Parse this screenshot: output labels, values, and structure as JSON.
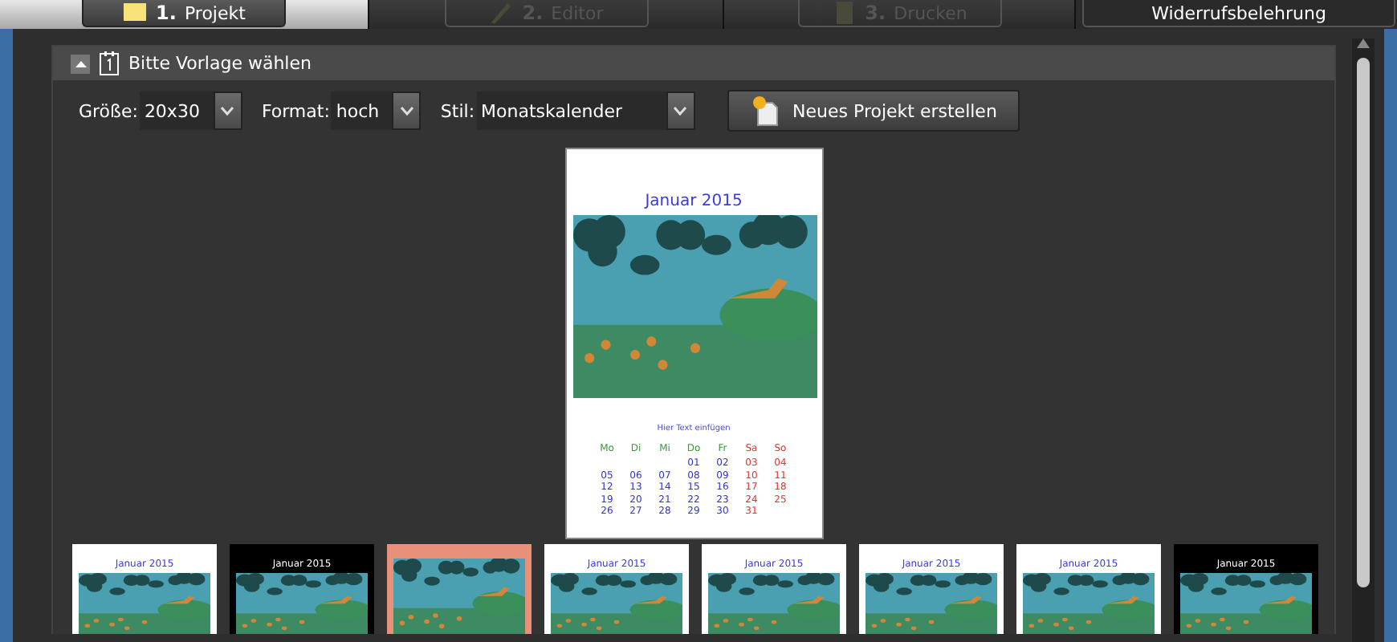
{
  "tabs": [
    {
      "number": "1.",
      "label": "Projekt",
      "selected": true,
      "disabled": false
    },
    {
      "number": "2.",
      "label": "Editor",
      "selected": false,
      "disabled": true
    },
    {
      "number": "3.",
      "label": "Drucken",
      "selected": false,
      "disabled": true
    }
  ],
  "top_button": "Widerrufsbelehrung",
  "panel": {
    "title": "Bitte Vorlage wählen",
    "expanded": true,
    "fields": [
      {
        "label": "Größe:",
        "value": "20x30"
      },
      {
        "label": "Format:",
        "value": "hoch"
      },
      {
        "label": "Stil:",
        "value": "Monatskalender"
      }
    ],
    "create_button": "Neues Projekt erstellen",
    "preview": {
      "title": "Januar 2015",
      "caption": "Hier Text einfügen",
      "weekdays": [
        {
          "label": "Mo",
          "weekend": false
        },
        {
          "label": "Di",
          "weekend": false
        },
        {
          "label": "Mi",
          "weekend": false
        },
        {
          "label": "Do",
          "weekend": false
        },
        {
          "label": "Fr",
          "weekend": false
        },
        {
          "label": "Sa",
          "weekend": true
        },
        {
          "label": "So",
          "weekend": true
        }
      ],
      "weeks": [
        {
          "partial": true,
          "days": [
            "01",
            "02",
            "03",
            "04"
          ]
        },
        {
          "partial": false,
          "days": [
            "05",
            "06",
            "07",
            "08",
            "09",
            "10",
            "11"
          ]
        },
        {
          "partial": false,
          "days": [
            "12",
            "13",
            "14",
            "15",
            "16",
            "17",
            "18"
          ]
        },
        {
          "partial": false,
          "days": [
            "19",
            "20",
            "21",
            "22",
            "23",
            "24",
            "25"
          ]
        },
        {
          "partial": true,
          "days": [
            "26",
            "27",
            "28",
            "29",
            "30",
            "31"
          ]
        }
      ]
    },
    "templates": [
      {
        "title": "Januar 2015",
        "color": "#ffffff",
        "selected": false
      },
      {
        "title": "Januar 2015",
        "color": "#000000",
        "selected": false
      },
      {
        "color": "#e8917a",
        "selected": false
      },
      {
        "title": "Januar 2015",
        "color": "#ffffff",
        "selected": false
      },
      {
        "title": "Januar 2015",
        "color": "#ffffff",
        "selected": false
      },
      {
        "title": "Januar 2015",
        "color": "#ffffff",
        "selected": false
      },
      {
        "title": "Januar 2015",
        "color": "#ffffff",
        "selected": false
      },
      {
        "title": "Januar 2015",
        "color": "#000000",
        "selected": false
      }
    ]
  }
}
